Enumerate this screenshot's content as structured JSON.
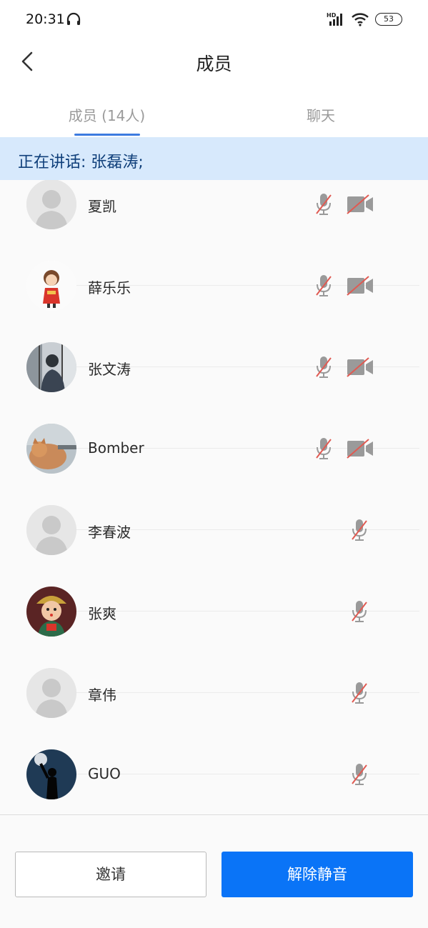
{
  "status_bar": {
    "time": "20:31",
    "network_label": "HD",
    "battery": "53",
    "icons": [
      "headset-icon",
      "signal-icon",
      "wifi-icon",
      "battery-icon"
    ]
  },
  "header": {
    "title": "成员",
    "back_icon": "chevron-left-icon"
  },
  "tabs": [
    {
      "label": "成员 (14人)",
      "active": true
    },
    {
      "label": "聊天",
      "active": false
    }
  ],
  "speaking": {
    "text": "正在讲话: 张磊涛;"
  },
  "members": [
    {
      "name": "夏凯",
      "avatar": "default-person",
      "mic_muted": true,
      "camera_off": true
    },
    {
      "name": "薛乐乐",
      "avatar": "cartoon-girl",
      "mic_muted": true,
      "camera_off": true
    },
    {
      "name": "张文涛",
      "avatar": "photo-person",
      "mic_muted": true,
      "camera_off": true
    },
    {
      "name": "Bomber",
      "avatar": "cat-photo",
      "mic_muted": true,
      "camera_off": true
    },
    {
      "name": "李春波",
      "avatar": "default-person",
      "mic_muted": true,
      "camera_off": null
    },
    {
      "name": "张爽",
      "avatar": "doll-figure",
      "mic_muted": true,
      "camera_off": null
    },
    {
      "name": "章伟",
      "avatar": "default-person",
      "mic_muted": true,
      "camera_off": null
    },
    {
      "name": "GUO",
      "avatar": "moon-silhouette",
      "mic_muted": true,
      "camera_off": null
    }
  ],
  "footer": {
    "invite_label": "邀请",
    "unmute_label": "解除静音"
  },
  "colors": {
    "accent": "#0a74f7",
    "tab_underline": "#3d7be0",
    "speaking_bg": "#d7e9fc",
    "speaking_text": "#0f3f7a",
    "muted_slash": "#e05a52",
    "icon_gray": "#9a9a9a"
  }
}
